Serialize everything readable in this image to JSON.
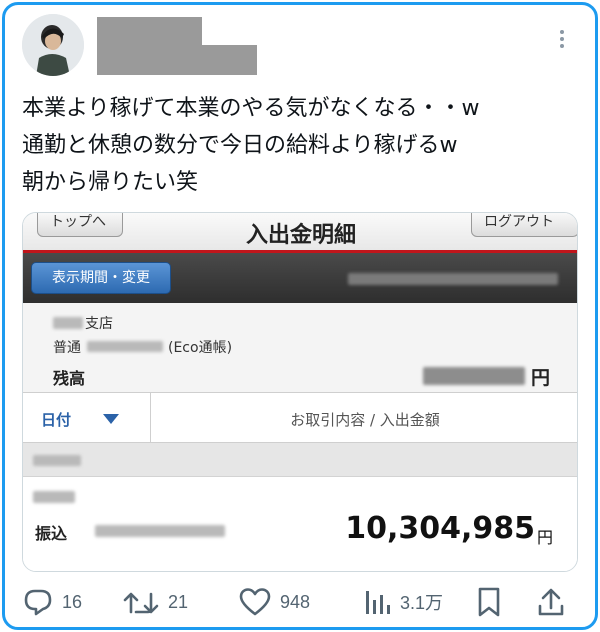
{
  "tweet": {
    "text": "本業より稼げて本業のやる気がなくなる・・w\n通勤と休憩の数分で今日の給料より稼げるw\n朝から帰りたい笑"
  },
  "screenshot": {
    "top_left_button": "トップへ",
    "title": "入出金明細",
    "top_right_button": "ログアウト",
    "period_button": "表示期間・変更",
    "branch_suffix": "支店",
    "account_type": "普通",
    "account_note": "(Eco通帳)",
    "balance_label": "残高",
    "balance_currency": "円",
    "col_date": "日付",
    "col_detail": "お取引内容 / 入出金額",
    "tx_label": "振込",
    "tx_amount": "10,304,985",
    "tx_currency": "円"
  },
  "actions": {
    "reply_count": "16",
    "retweet_count": "21",
    "like_count": "948",
    "views_count": "3.1万"
  },
  "colors": {
    "accent": "#1d9bf0",
    "icon_gray": "#536471",
    "header_red": "#c0151b",
    "period_blue": "#2d6ab1"
  },
  "icons": [
    "more-icon",
    "reply-icon",
    "retweet-icon",
    "like-icon",
    "views-icon",
    "bookmark-icon",
    "share-icon"
  ]
}
